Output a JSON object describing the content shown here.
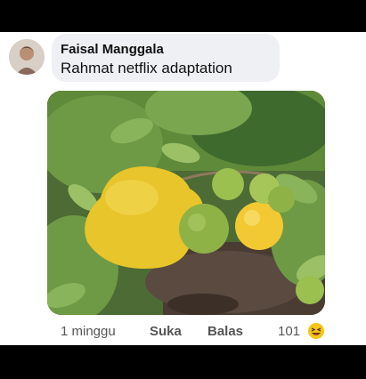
{
  "comment": {
    "author": "Faisal Manggala",
    "text": "Rahmat netflix adaptation",
    "time": "1 minggu",
    "like_label": "Suka",
    "reply_label": "Balas",
    "reaction_count": "101",
    "reaction_icon": "laughing-emoji-icon"
  },
  "colors": {
    "bubble": "#eef0f3",
    "fruit_yellow": "#e8c52a",
    "leaf_green": "#5f8a3a"
  }
}
